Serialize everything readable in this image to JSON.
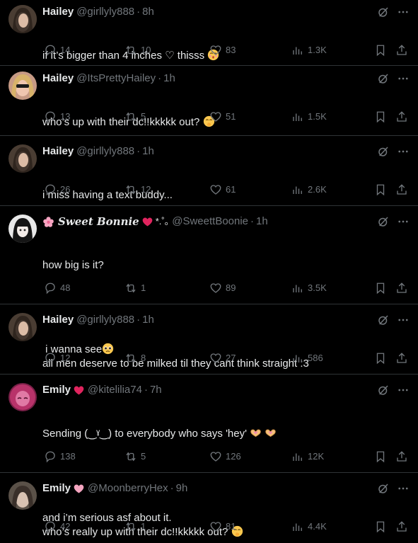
{
  "feed": {
    "tweets": [
      {
        "name": "Hailey",
        "handle": "@girllyly888",
        "time": "8h",
        "lines": [
          "if it’s bigger than 4 inches ♡ thisss"
        ],
        "emoji": "kissing-emoji",
        "replies": "14",
        "reposts": "10",
        "likes": "83",
        "views": "1.3K"
      },
      {
        "name": "Hailey",
        "handle": "@ItsPrettyHailey",
        "time": "1h",
        "lines": [
          "who’s up with their dc!!kkkkk out?"
        ],
        "emoji": "shushing-face-emoji",
        "replies": "13",
        "reposts": "5",
        "likes": "51",
        "views": "1.5K"
      },
      {
        "name": "Hailey",
        "handle": "@girllyly888",
        "time": "1h",
        "lines": [
          "i miss having a text buddy..."
        ],
        "replies": "26",
        "reposts": "12",
        "likes": "61",
        "views": "2.6K"
      },
      {
        "name": "𝑺𝒘𝒆𝒆𝒕 𝑩𝒐𝒏𝒏𝒊𝒆",
        "name_suffix": "*.˚｡",
        "handle": "@SweettBoonie",
        "time": "1h",
        "lines": [
          "how big is it?",
          "",
          " i wanna see"
        ],
        "emoji": "pleading-face-emoji",
        "replies": "48",
        "reposts": "1",
        "likes": "89",
        "views": "3.5K"
      },
      {
        "name": "Hailey",
        "handle": "@girllyly888",
        "time": "1h",
        "lines": [
          "all men deserve to be milked til they cant think straight :3"
        ],
        "replies": "12",
        "reposts": "8",
        "likes": "27",
        "views": "586"
      },
      {
        "name": "Emily",
        "handle": "@kitelilia74",
        "time": "7h",
        "lines": [
          "Sending (‿ˠ‿) to everybody who says 'hey'",
          "",
          "and i’m serious asf about it."
        ],
        "emoji": "heart-hands-emoji",
        "replies": "138",
        "reposts": "5",
        "likes": "126",
        "views": "12K"
      },
      {
        "name": "Emily",
        "handle": "@MoonberryHex",
        "time": "9h",
        "lines": [
          "who’s really up with their dc!!kkkkk out?"
        ],
        "emoji": "shushing-face-emoji",
        "replies": "42",
        "reposts": "1",
        "likes": "81",
        "views": "4.4K"
      }
    ]
  },
  "colors": {
    "background": "#000000",
    "text": "#e7e9ea",
    "muted": "#71767b",
    "divider": "#2f3336",
    "red_heart": "#e0245e",
    "pink_heart": "#f4a5c0"
  }
}
